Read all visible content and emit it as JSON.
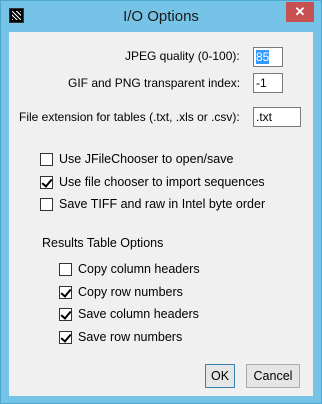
{
  "window": {
    "title": "I/O Options",
    "close_glyph": "✕"
  },
  "fields": [
    {
      "label": "JPEG quality (0-100):",
      "value": "85"
    },
    {
      "label": "GIF and PNG transparent index:",
      "value": "-1"
    },
    {
      "label": "File extension for tables (.txt, .xls or .csv):",
      "value": ".txt"
    }
  ],
  "options": [
    {
      "label": "Use JFileChooser to open/save",
      "checked": false
    },
    {
      "label": "Use file chooser to import sequences",
      "checked": true
    },
    {
      "label": "Save TIFF and raw in Intel byte order",
      "checked": false
    }
  ],
  "results_table": {
    "title": "Results Table Options",
    "options": [
      {
        "label": "Copy column headers",
        "checked": false
      },
      {
        "label": "Copy row numbers",
        "checked": true
      },
      {
        "label": "Save column headers",
        "checked": true
      },
      {
        "label": "Save row numbers",
        "checked": true
      }
    ]
  },
  "buttons": {
    "ok": "OK",
    "cancel": "Cancel"
  }
}
